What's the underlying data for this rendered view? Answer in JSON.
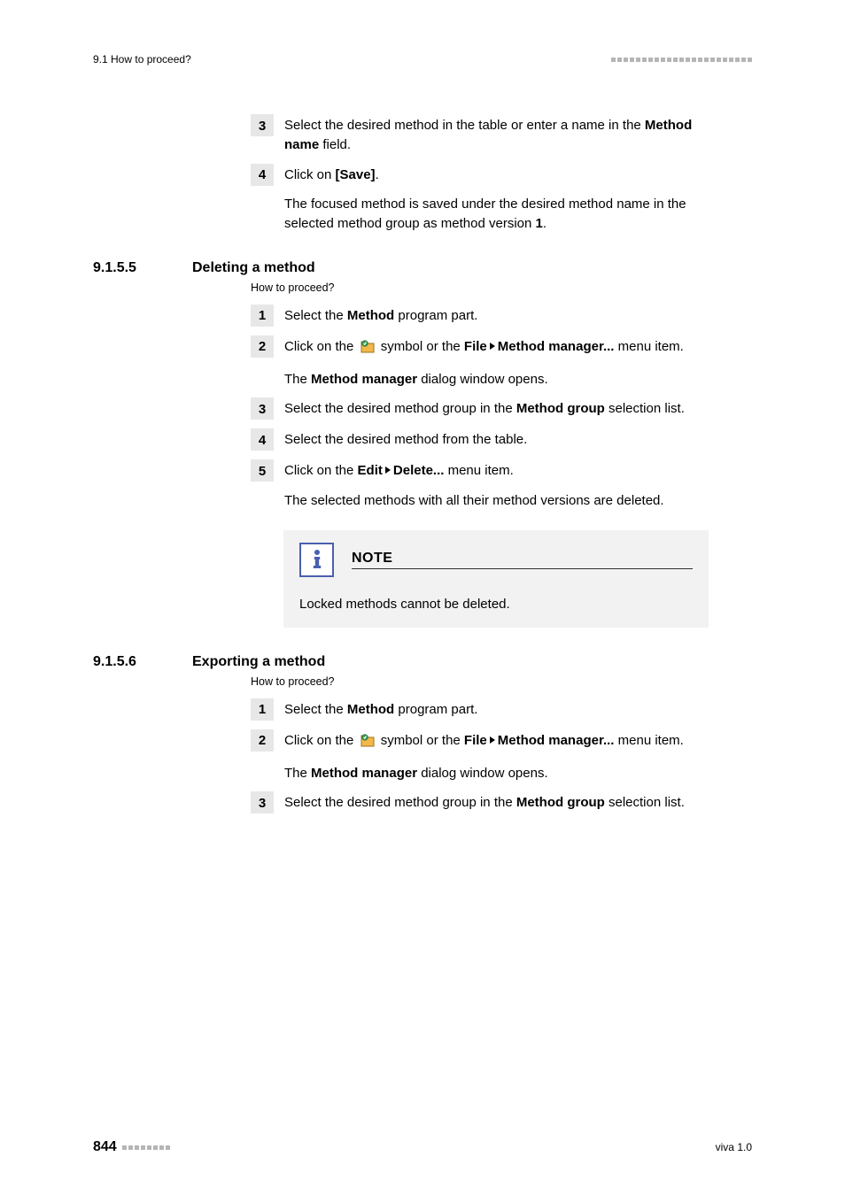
{
  "header": {
    "left": "9.1 How to proceed?"
  },
  "top_steps": {
    "s3_num": "3",
    "s3_a": "Select the desired method in the table or enter a name in the ",
    "s3_b": "Method name",
    "s3_c": " field.",
    "s4_num": "4",
    "s4_a": "Click on ",
    "s4_b": "[Save]",
    "s4_c": ".",
    "s4_d": "The focused method is saved under the desired method name in the selected method group as method version ",
    "s4_e": "1",
    "s4_f": "."
  },
  "h1": {
    "num": "9.1.5.5",
    "txt": "Deleting a method",
    "sub": "How to proceed?"
  },
  "del": {
    "s1_num": "1",
    "s1_a": "Select the ",
    "s1_b": "Method",
    "s1_c": " program part.",
    "s2_num": "2",
    "s2_a": "Click on the ",
    "s2_b": " symbol or the ",
    "s2_c": "File",
    "s2_d": "Method manager...",
    "s2_e": " menu item.",
    "s2_f": "The ",
    "s2_g": "Method manager",
    "s2_h": " dialog window opens.",
    "s3_num": "3",
    "s3_a": "Select the desired method group in the ",
    "s3_b": "Method group",
    "s3_c": " selection list.",
    "s4_num": "4",
    "s4_a": "Select the desired method from the table.",
    "s5_num": "5",
    "s5_a": "Click on the ",
    "s5_b": "Edit",
    "s5_c": "Delete...",
    "s5_d": " menu item.",
    "s5_e": "The selected methods with all their method versions are deleted."
  },
  "note": {
    "title": "NOTE",
    "body": "Locked methods cannot be deleted."
  },
  "h2": {
    "num": "9.1.5.6",
    "txt": "Exporting a method",
    "sub": "How to proceed?"
  },
  "exp": {
    "s1_num": "1",
    "s1_a": "Select the ",
    "s1_b": "Method",
    "s1_c": " program part.",
    "s2_num": "2",
    "s2_a": "Click on the ",
    "s2_b": " symbol or the ",
    "s2_c": "File",
    "s2_d": "Method manager...",
    "s2_e": " menu item.",
    "s2_f": "The ",
    "s2_g": "Method manager",
    "s2_h": " dialog window opens.",
    "s3_num": "3",
    "s3_a": "Select the desired method group in the ",
    "s3_b": "Method group",
    "s3_c": " selection list."
  },
  "footer": {
    "page": "844",
    "right": "viva 1.0"
  }
}
